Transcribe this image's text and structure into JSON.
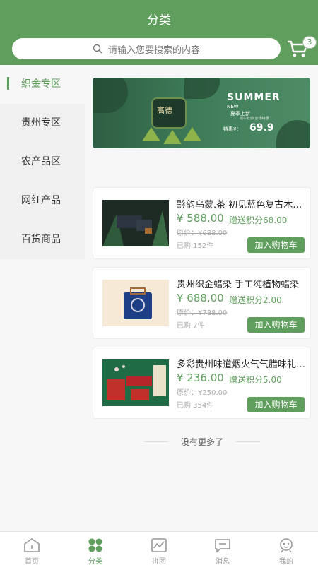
{
  "header": {
    "title": "分类",
    "search_placeholder": "请输入您要搜索的内容",
    "cart_count": "3"
  },
  "sidebar": {
    "items": [
      {
        "label": "织金专区",
        "active": true
      },
      {
        "label": "贵州专区",
        "active": false
      },
      {
        "label": "农产品区",
        "active": false
      },
      {
        "label": "网红产品",
        "active": false
      },
      {
        "label": "百货商品",
        "active": false
      }
    ]
  },
  "banner": {
    "title": "SUMMER",
    "subtitle": "NEW",
    "tag": "夏季上新",
    "tag2": "端午安康 全场特惠",
    "price_label": "特惠¥：",
    "price": "69.9",
    "jar_text": "高德"
  },
  "products": [
    {
      "name": "黔韵乌蒙.茶 初见蓝色复古木盒装",
      "price": "¥ 588.00",
      "points": "赠送积分68.00",
      "orig_price": "原价：¥688.00",
      "sold": "已购 152件",
      "button": "加入购物车"
    },
    {
      "name": "贵州织金蜡染 手工纯植物蜡染",
      "price": "¥ 688.00",
      "points": "赠送积分2.00",
      "orig_price": "原价：¥788.00",
      "sold": "已购 7件",
      "button": "加入购物车"
    },
    {
      "name": "多彩贵州味道烟火气气腊味礼盒装",
      "price": "¥ 236.00",
      "points": "赠送积分5.00",
      "orig_price": "原价：¥250.00",
      "sold": "已购 354件",
      "button": "加入购物车"
    }
  ],
  "footer_note": "没有更多了",
  "tabbar": [
    {
      "label": "首页",
      "icon": "home-icon",
      "active": false
    },
    {
      "label": "分类",
      "icon": "category-icon",
      "active": true
    },
    {
      "label": "拼团",
      "icon": "group-buy-icon",
      "active": false
    },
    {
      "label": "消息",
      "icon": "message-icon",
      "active": false
    },
    {
      "label": "我的",
      "icon": "profile-icon",
      "active": false
    }
  ],
  "colors": {
    "accent": "#5f9e5c",
    "background": "#f7f7f7"
  }
}
